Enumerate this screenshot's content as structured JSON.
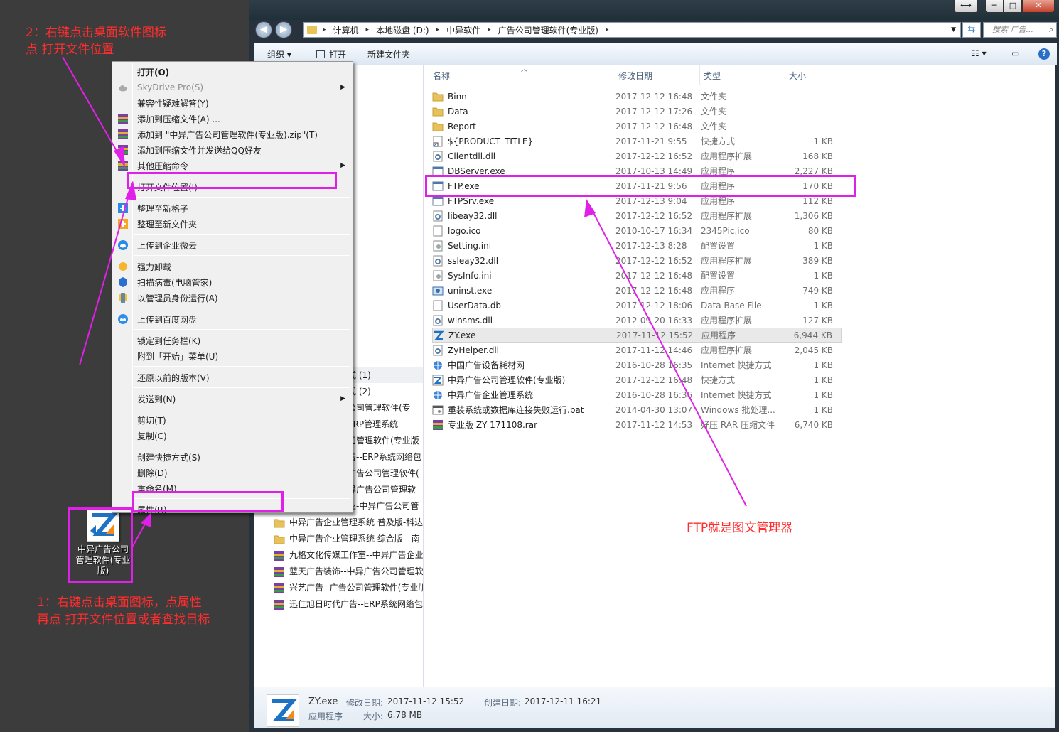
{
  "annotations": {
    "step2_line1": "2：右键点击桌面软件图标",
    "step2_line2": "点 打开文件位置",
    "step1_line1": "1：右键点击桌面图标，点属性",
    "step1_line2": "再点 打开文件位置或者查找目标",
    "ftp_note": "FTP就是图文管理器",
    "color": "#ff2d2d",
    "highlight_color": "#e020e8"
  },
  "desktop_icon": {
    "label": "中异广告公司管理软件(专业版)"
  },
  "window": {
    "buttons": {
      "resize": "⟷",
      "minimize": "─",
      "maximize": "□",
      "close": "✕"
    },
    "address": {
      "crumbs": [
        "计算机",
        "本地磁盘 (D:)",
        "中异软件",
        "广告公司管理软件(专业版)"
      ],
      "separator": "▸"
    },
    "search_placeholder": "搜索 广告...",
    "toolbar": {
      "organize": "组织 ▾",
      "open": "打开",
      "new_folder": "新建文件夹"
    },
    "columns": {
      "name": "名称",
      "date": "修改日期",
      "type": "类型",
      "size": "大小"
    }
  },
  "files": [
    {
      "name": "Binn",
      "date": "2017-12-12 16:48",
      "type": "文件夹",
      "size": "",
      "icon": "folder-icon"
    },
    {
      "name": "Data",
      "date": "2017-12-12 17:26",
      "type": "文件夹",
      "size": "",
      "icon": "folder-icon"
    },
    {
      "name": "Report",
      "date": "2017-12-12 16:48",
      "type": "文件夹",
      "size": "",
      "icon": "folder-icon"
    },
    {
      "name": "${PRODUCT_TITLE}",
      "date": "2017-11-21 9:55",
      "type": "快捷方式",
      "size": "1 KB",
      "icon": "shortcut-icon"
    },
    {
      "name": "Clientdll.dll",
      "date": "2017-12-12 16:52",
      "type": "应用程序扩展",
      "size": "168 KB",
      "icon": "dll-icon"
    },
    {
      "name": "DBServer.exe",
      "date": "2017-10-13 14:49",
      "type": "应用程序",
      "size": "2,227 KB",
      "icon": "exe-icon"
    },
    {
      "name": "FTP.exe",
      "date": "2017-11-21 9:56",
      "type": "应用程序",
      "size": "170 KB",
      "icon": "exe-icon"
    },
    {
      "name": "FTPSrv.exe",
      "date": "2017-12-13 9:04",
      "type": "应用程序",
      "size": "112 KB",
      "icon": "exe-icon"
    },
    {
      "name": "libeay32.dll",
      "date": "2017-12-12 16:52",
      "type": "应用程序扩展",
      "size": "1,306 KB",
      "icon": "dll-icon"
    },
    {
      "name": "logo.ico",
      "date": "2010-10-17 16:34",
      "type": "2345Pic.ico",
      "size": "80 KB",
      "icon": "file-icon"
    },
    {
      "name": "Setting.ini",
      "date": "2017-12-13 8:28",
      "type": "配置设置",
      "size": "1 KB",
      "icon": "ini-icon"
    },
    {
      "name": "ssleay32.dll",
      "date": "2017-12-12 16:52",
      "type": "应用程序扩展",
      "size": "389 KB",
      "icon": "dll-icon"
    },
    {
      "name": "SysInfo.ini",
      "date": "2017-12-12 16:48",
      "type": "配置设置",
      "size": "1 KB",
      "icon": "ini-icon"
    },
    {
      "name": "uninst.exe",
      "date": "2017-12-12 16:48",
      "type": "应用程序",
      "size": "749 KB",
      "icon": "uninstall-icon"
    },
    {
      "name": "UserData.db",
      "date": "2017-12-12 18:06",
      "type": "Data Base File",
      "size": "1 KB",
      "icon": "file-icon"
    },
    {
      "name": "winsms.dll",
      "date": "2012-09-20 16:33",
      "type": "应用程序扩展",
      "size": "127 KB",
      "icon": "dll-icon"
    },
    {
      "name": "ZY.exe",
      "date": "2017-11-12 15:52",
      "type": "应用程序",
      "size": "6,944 KB",
      "icon": "zy-app-icon",
      "selected": true
    },
    {
      "name": "ZyHelper.dll",
      "date": "2017-11-12 14:46",
      "type": "应用程序扩展",
      "size": "2,045 KB",
      "icon": "dll-icon"
    },
    {
      "name": "中国广告设备耗材网",
      "date": "2016-10-28 16:35",
      "type": "Internet 快捷方式",
      "size": "1 KB",
      "icon": "internet-shortcut-icon"
    },
    {
      "name": "中异广告公司管理软件(专业版)",
      "date": "2017-12-12 16:48",
      "type": "快捷方式",
      "size": "1 KB",
      "icon": "zy-shortcut-icon"
    },
    {
      "name": "中异广告企业管理系统",
      "date": "2016-10-28 16:36",
      "type": "Internet 快捷方式",
      "size": "1 KB",
      "icon": "internet-shortcut-icon"
    },
    {
      "name": "重装系统或数据库连接失败运行.bat",
      "date": "2014-04-30 13:07",
      "type": "Windows 批处理...",
      "size": "1 KB",
      "icon": "bat-icon"
    },
    {
      "name": "专业版 ZY 171108.rar",
      "date": "2017-11-12 14:53",
      "type": "好压 RAR 压缩文件",
      "size": "6,740 KB",
      "icon": "rar-icon"
    }
  ],
  "navpane": [
    {
      "label": "式 (1)",
      "icon": ""
    },
    {
      "label": "式 (2)",
      "icon": ""
    },
    {
      "label": "公司管理软件(专",
      "icon": ""
    },
    {
      "label": "ERP管理系统",
      "icon": ""
    },
    {
      "label": "司管理软件(专业版",
      "icon": ""
    },
    {
      "label": "告--ERP系统网络包",
      "icon": ""
    },
    {
      "label": "广告公司管理软件(",
      "icon": ""
    },
    {
      "label": "异广告公司管理软",
      "icon": ""
    },
    {
      "label": "业-中异广告公司管",
      "icon": ""
    },
    {
      "label": "中异广告企业管理系统 普及版-科达",
      "icon": "folder-icon"
    },
    {
      "label": "中异广告企业管理系统 综合版 - 南",
      "icon": "folder-icon"
    },
    {
      "label": "九格文化传媒工作室--中异广告企业",
      "icon": "rar-icon"
    },
    {
      "label": "蓝天广告装饰--中异广告公司管理软",
      "icon": "rar-icon"
    },
    {
      "label": "兴艺广告--广告公司管理软件(专业版",
      "icon": "rar-icon"
    },
    {
      "label": "迅佳旭日时代广告--ERP系统网络包",
      "icon": "rar-icon"
    }
  ],
  "details": {
    "name": "ZY.exe",
    "kind": "应用程序",
    "modified_label": "修改日期:",
    "modified": "2017-11-12 15:52",
    "created_label": "创建日期:",
    "created": "2017-12-11 16:21",
    "size_label": "大小:",
    "size": "6.78 MB"
  },
  "context_menu": [
    {
      "label": "打开(O)",
      "bold": true,
      "icon": ""
    },
    {
      "label": "SkyDrive Pro(S)",
      "disabled": true,
      "submenu": true,
      "icon": "cloud-icon"
    },
    {
      "label": "兼容性疑难解答(Y)",
      "icon": ""
    },
    {
      "label": "添加到压缩文件(A) ...",
      "icon": "archive-icon"
    },
    {
      "label": "添加到 \"中异广告公司管理软件(专业版).zip\"(T)",
      "icon": "archive-icon"
    },
    {
      "label": "添加到压缩文件并发送给QQ好友",
      "icon": "archive-icon"
    },
    {
      "label": "其他压缩命令",
      "submenu": true,
      "icon": "archive-icon"
    },
    {
      "sep": true
    },
    {
      "label": "打开文件位置(I)",
      "icon": ""
    },
    {
      "sep": true
    },
    {
      "label": "整理至新格子",
      "icon": "plus-blue-icon"
    },
    {
      "label": "整理至新文件夹",
      "icon": "plus-orange-icon"
    },
    {
      "sep": true
    },
    {
      "label": "上传到企业微云",
      "icon": "weiyun-icon"
    },
    {
      "sep": true
    },
    {
      "label": "强力卸载",
      "icon": "uninstall-tool-icon"
    },
    {
      "label": "扫描病毒(电脑管家)",
      "icon": "shield-icon"
    },
    {
      "label": "以管理员身份运行(A)",
      "icon": "uac-shield-icon"
    },
    {
      "sep": true
    },
    {
      "label": "上传到百度网盘",
      "icon": "baidu-cloud-icon"
    },
    {
      "sep": true
    },
    {
      "label": "锁定到任务栏(K)",
      "icon": ""
    },
    {
      "label": "附到「开始」菜单(U)",
      "icon": ""
    },
    {
      "sep": true
    },
    {
      "label": "还原以前的版本(V)",
      "icon": ""
    },
    {
      "sep": true
    },
    {
      "label": "发送到(N)",
      "submenu": true,
      "icon": ""
    },
    {
      "sep": true
    },
    {
      "label": "剪切(T)",
      "icon": ""
    },
    {
      "label": "复制(C)",
      "icon": ""
    },
    {
      "sep": true
    },
    {
      "label": "创建快捷方式(S)",
      "icon": ""
    },
    {
      "label": "删除(D)",
      "icon": ""
    },
    {
      "label": "重命名(M)",
      "icon": ""
    },
    {
      "sep": true
    },
    {
      "label": "属性(R)",
      "icon": ""
    }
  ]
}
